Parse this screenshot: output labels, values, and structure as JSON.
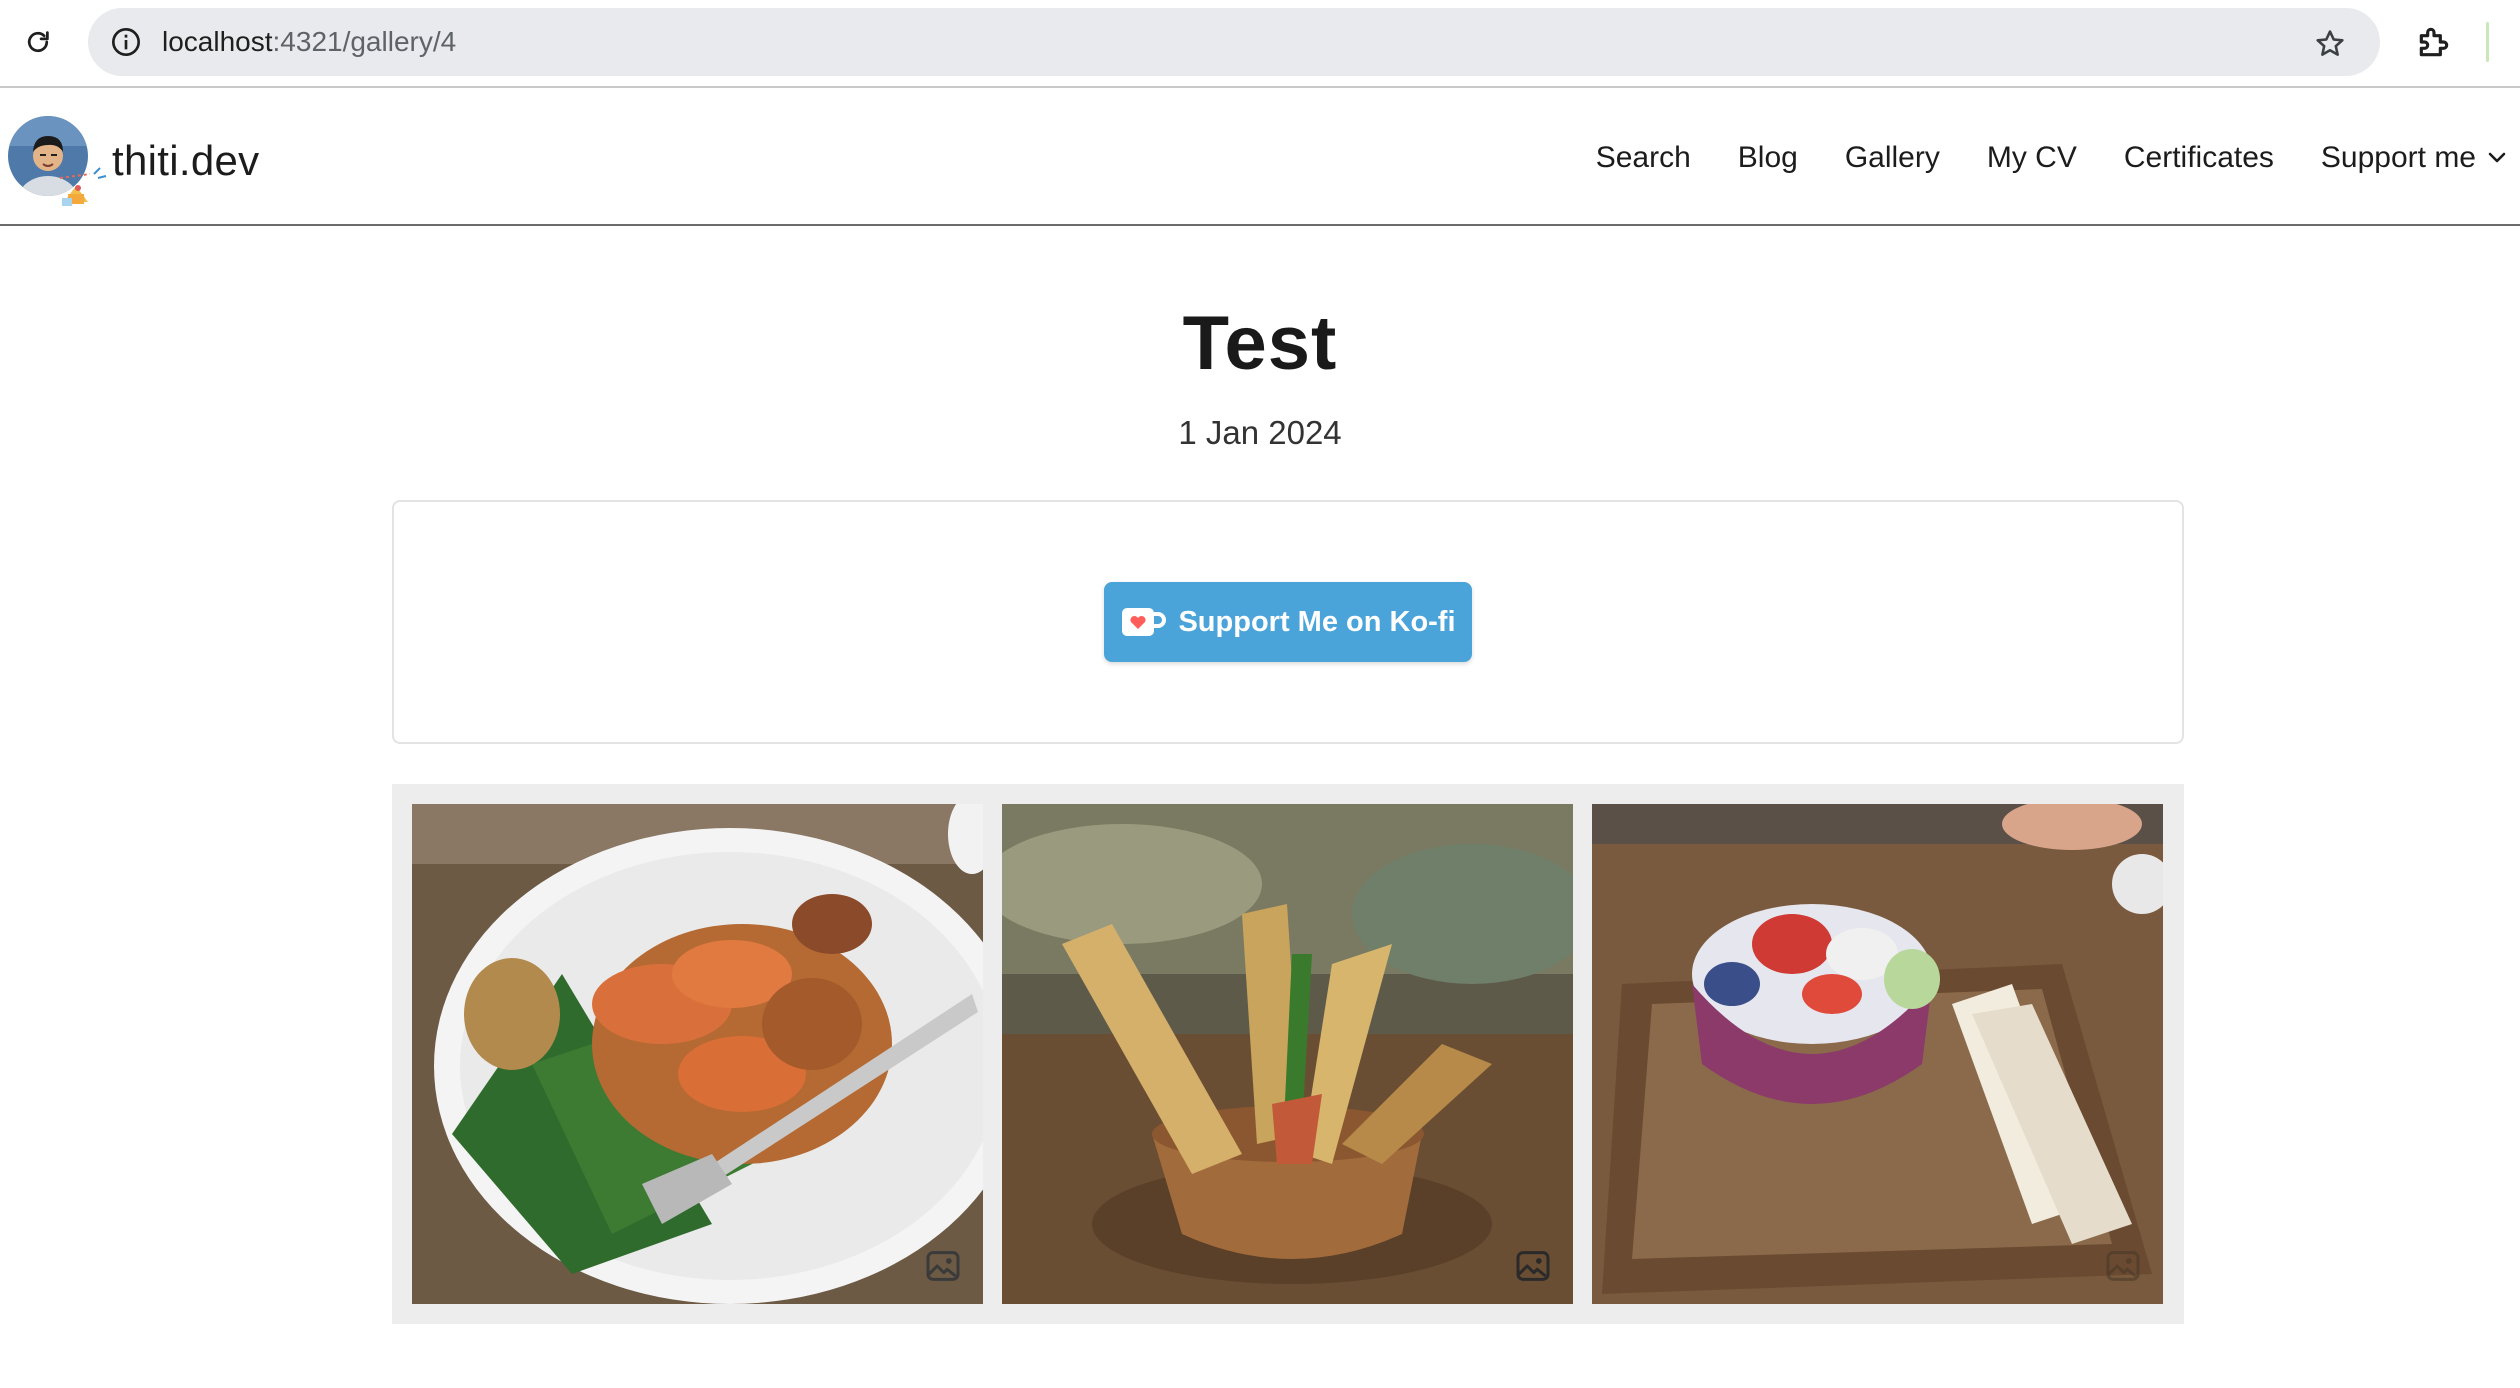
{
  "browser": {
    "url_host": "localhost",
    "url_path": ":4321/gallery/4"
  },
  "site": {
    "brand": "thiti.dev",
    "nav": [
      {
        "label": "Search"
      },
      {
        "label": "Blog"
      },
      {
        "label": "Gallery"
      },
      {
        "label": "My CV"
      },
      {
        "label": "Certificates"
      },
      {
        "label": "Support me",
        "has_dropdown": true
      }
    ]
  },
  "page": {
    "title": "Test",
    "date": "1 Jan 2024"
  },
  "kofi": {
    "label": "Support Me on Ko-fi",
    "color": "#4aa3d9"
  },
  "gallery": {
    "photos": [
      {
        "icon": "image-icon"
      },
      {
        "icon": "image-icon"
      },
      {
        "icon": "image-icon"
      }
    ]
  }
}
